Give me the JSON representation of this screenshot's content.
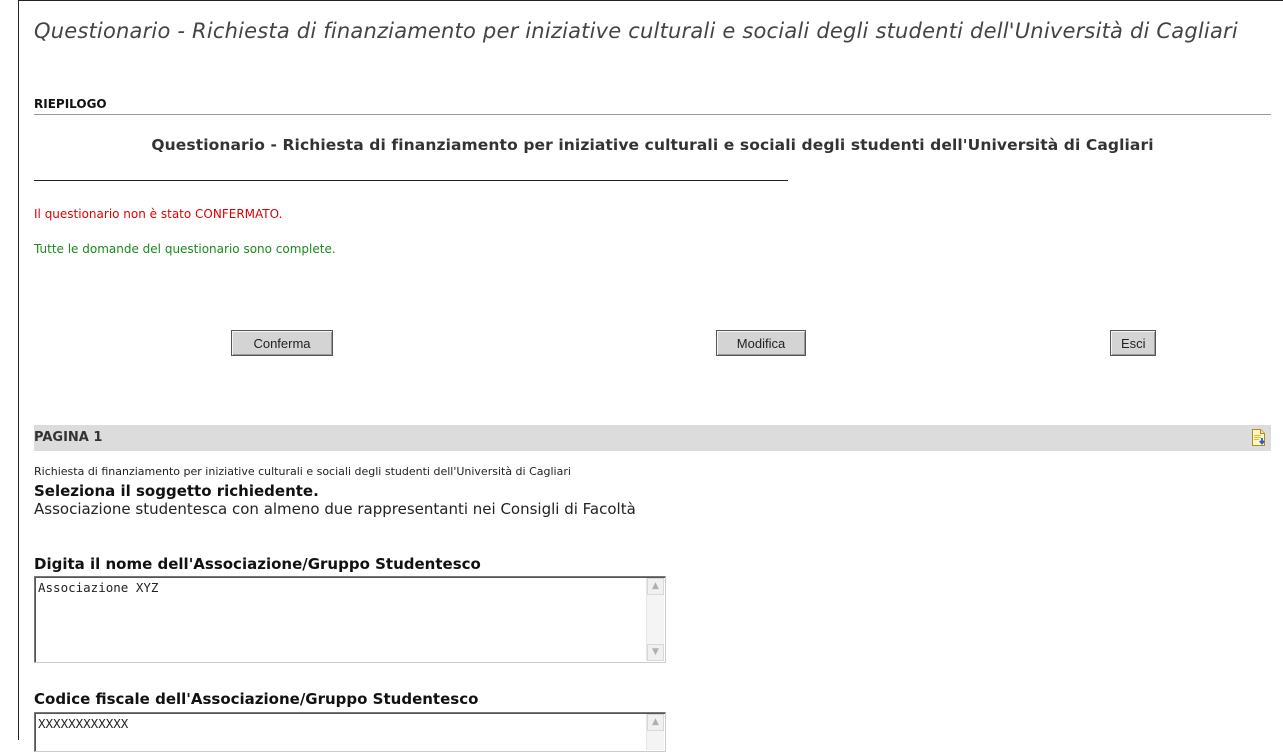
{
  "header": {
    "title": "Questionario - Richiesta di finanziamento per iniziative culturali e sociali degli studenti dell'Università di Cagliari"
  },
  "summary": {
    "section_label": "RIEPILOGO",
    "subtitle": "Questionario - Richiesta di finanziamento per iniziative culturali e sociali degli studenti dell'Università di Cagliari",
    "status_not_confirmed_prefix": "Il questionario non è stato ",
    "status_not_confirmed_emphasis": "CONFERMATO.",
    "status_complete": "Tutte le domande del questionario sono complete."
  },
  "actions": {
    "confirm_label": "Conferma",
    "modify_label": "Modifica",
    "exit_label": "Esci"
  },
  "page1": {
    "bar_label": "PAGINA 1",
    "pdf_icon": "document-download-icon",
    "description": "Richiesta di finanziamento per iniziative culturali e sociali degli studenti dell'Università di Cagliari",
    "questions": [
      {
        "label": "Seleziona il soggetto richiedente.",
        "answer": "Associazione studentesca con almeno due rappresentanti nei Consigli di Facoltà"
      },
      {
        "label": "Digita il nome dell'Associazione/Gruppo Studentesco",
        "answer": "Associazione XYZ"
      },
      {
        "label": "Codice fiscale dell'Associazione/Gruppo Studentesco",
        "answer": "XXXXXXXXXXXX"
      }
    ]
  },
  "colors": {
    "error": "#e00000",
    "success": "#1a8a1a",
    "page_bar": "#dcdcdc",
    "button": "#d4d4d4"
  }
}
